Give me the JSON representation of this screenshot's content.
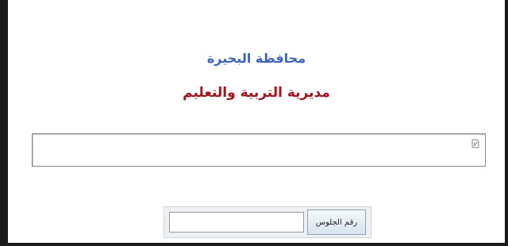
{
  "header": {
    "governorate": "محافظة البحيرة",
    "directorate": "مديرية التربية والتعليم"
  },
  "banner": {
    "icon": "broken-image-icon"
  },
  "form": {
    "seat_number_button": "رقم الجلوس",
    "seat_number_value": ""
  },
  "colors": {
    "governorate_text": "#3b64c0",
    "directorate_text": "#a3141e"
  }
}
